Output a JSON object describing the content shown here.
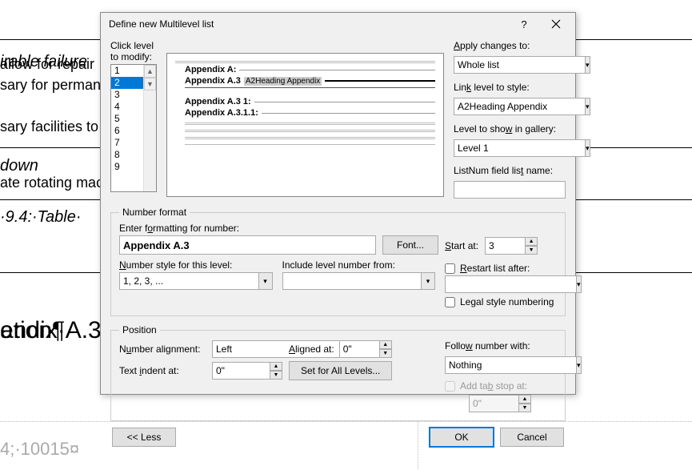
{
  "dialog": {
    "title": "Define new Multilevel list"
  },
  "levels": {
    "label": "Click level to modify:",
    "items": [
      "1",
      "2",
      "3",
      "4",
      "5",
      "6",
      "7",
      "8",
      "9"
    ],
    "selected": "2"
  },
  "preview": {
    "l1": "Appendix A:",
    "l2": "Appendix A.3",
    "l2_style": "A2Heading Appendix",
    "l3": "Appendix A.3 1:",
    "l4": "Appendix A.3.1.1:"
  },
  "apply": {
    "label": "Apply changes to:",
    "value": "Whole list",
    "link_label": "Link level to style:",
    "link_value": "A2Heading Appendix",
    "show_label": "Level to show in gallery:",
    "show_value": "Level 1",
    "listnum_label": "ListNum field list name:",
    "listnum_value": ""
  },
  "nf": {
    "legend": "Number format",
    "enter_label": "Enter formatting for number:",
    "enter_value": "Appendix A.3",
    "font_btn": "Font...",
    "style_label": "Number style for this level:",
    "style_value": "1, 2, 3, ...",
    "include_label": "Include level number from:",
    "include_value": "",
    "start_label": "Start at:",
    "start_value": "3",
    "restart_label": "Restart list after:",
    "restart_value": "",
    "legal_label": "Legal style numbering"
  },
  "pos": {
    "legend": "Position",
    "align_label": "Number alignment:",
    "align_value": "Left",
    "aligned_at_label": "Aligned at:",
    "aligned_at_value": "0\"",
    "indent_label": "Text indent at:",
    "indent_value": "0\"",
    "set_all_btn": "Set for All Levels...",
    "follow_label": "Follow number with:",
    "follow_value": "Nothing",
    "addtab_label": "Add tab stop at:",
    "addtab_value": "0\""
  },
  "footer": {
    "less": "<< Less",
    "ok": "OK",
    "cancel": "Cancel"
  },
  "bg": {
    "irable": "irable failure",
    "down": "down",
    "table": "·9.4:·Table·",
    "endix": "endix·A.3",
    "pilcrow": "ation¶",
    "allow": "allow for repair",
    "sary": "sary for perman",
    "facilities": "sary facilities to",
    "rotating": "ate rotating mac",
    "foot": "4;·10015¤"
  }
}
